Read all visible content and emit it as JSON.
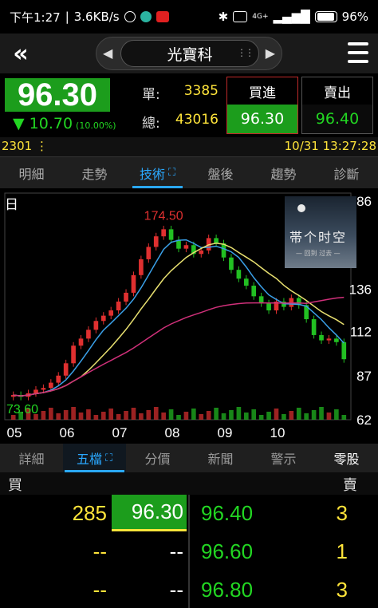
{
  "statusbar": {
    "time": "下午1:27",
    "speed": "3.6KB/s",
    "network": "4G+",
    "battery": "96%"
  },
  "header": {
    "stock_name": "光寶科"
  },
  "quote": {
    "price": "96.30",
    "change": "▼ 10.70",
    "change_pct": "(10.00%)",
    "single_label": "單:",
    "single_vol": "3385",
    "total_label": "總:",
    "total_vol": "43016",
    "bid_label": "買進",
    "bid_price": "96.30",
    "ask_label": "賣出",
    "ask_price": "96.40"
  },
  "code_row": {
    "code": "2301",
    "datetime": "10/31 13:27:28"
  },
  "tabs": [
    "明細",
    "走勢",
    "技術",
    "盤後",
    "趨勢",
    "診斷"
  ],
  "chart": {
    "period_label": "日"
  },
  "thumbnail": {
    "title": "帯个时空",
    "subtitle": "— 回到 过去 —"
  },
  "chart_data": {
    "type": "candlestick",
    "period": "daily",
    "x_tick_labels": [
      "05",
      "06",
      "07",
      "08",
      "09",
      "10"
    ],
    "y_tick_labels": [
      "186",
      "136",
      "112",
      "87",
      "62"
    ],
    "ylim": [
      62,
      186
    ],
    "max_label": "174.50",
    "min_label": "73.60",
    "series": [
      {
        "name": "close",
        "values": [
          76,
          75,
          77,
          79,
          80,
          83,
          87,
          94,
          104,
          108,
          113,
          118,
          121,
          124,
          129,
          134,
          144,
          153,
          160,
          166,
          170,
          164,
          159,
          161,
          156,
          158,
          165,
          162,
          154,
          147,
          142,
          138,
          132,
          128,
          124,
          129,
          126,
          131,
          127,
          119,
          110,
          107,
          108,
          106,
          96.3
        ]
      }
    ],
    "moving_averages": [
      {
        "color": "#3aa0e8"
      },
      {
        "color": "#e8e070"
      },
      {
        "color": "#d0307a"
      }
    ],
    "colors": {
      "up": "#e03030",
      "down": "#22c022"
    }
  },
  "lower_tabs": [
    "詳細",
    "五檔",
    "分價",
    "新聞",
    "警示",
    "零股"
  ],
  "book": {
    "buy_label": "買",
    "sell_label": "賣",
    "rows": [
      {
        "bid_qty": "285",
        "bid_price": "96.30",
        "ask_price": "96.40",
        "ask_qty": "3"
      },
      {
        "bid_qty": "--",
        "bid_price": "--",
        "ask_price": "96.60",
        "ask_qty": "1"
      },
      {
        "bid_qty": "--",
        "bid_price": "--",
        "ask_price": "96.80",
        "ask_qty": "3"
      }
    ]
  }
}
